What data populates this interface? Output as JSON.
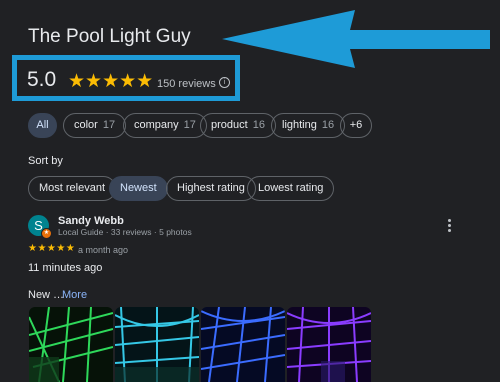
{
  "business": {
    "name": "The Pool Light Guy",
    "rating": "5.0",
    "stars": "★★★★★",
    "review_count": "150 reviews",
    "info_icon": "i"
  },
  "filters": [
    {
      "label": "All",
      "count": "",
      "active": true
    },
    {
      "label": "color",
      "count": "17"
    },
    {
      "label": "company",
      "count": "17"
    },
    {
      "label": "product",
      "count": "16"
    },
    {
      "label": "lighting",
      "count": "16"
    },
    {
      "label": "+6",
      "count": ""
    }
  ],
  "sort": {
    "label": "Sort by",
    "options": [
      "Most relevant",
      "Newest",
      "Highest rating",
      "Lowest rating"
    ],
    "selected": "Newest"
  },
  "review": {
    "avatar_initial": "S",
    "reviewer_name": "Sandy Webb",
    "reviewer_meta": "Local Guide · 33 reviews · 5 photos",
    "stars": "★★★★★",
    "date": "a month ago",
    "posted": "11 minutes ago",
    "text": "New …",
    "more_label": "More"
  },
  "photos": [
    {
      "name": "photo-green-lights",
      "color": "#2ed85a"
    },
    {
      "name": "photo-teal-lights",
      "color": "#35c8e6"
    },
    {
      "name": "photo-blue-lights",
      "color": "#3b6cff"
    },
    {
      "name": "photo-purple-lights",
      "color": "#8a3cff"
    }
  ],
  "annotation": {
    "arrow_color": "#1e9bd7",
    "box_color": "#1e9bd7"
  }
}
